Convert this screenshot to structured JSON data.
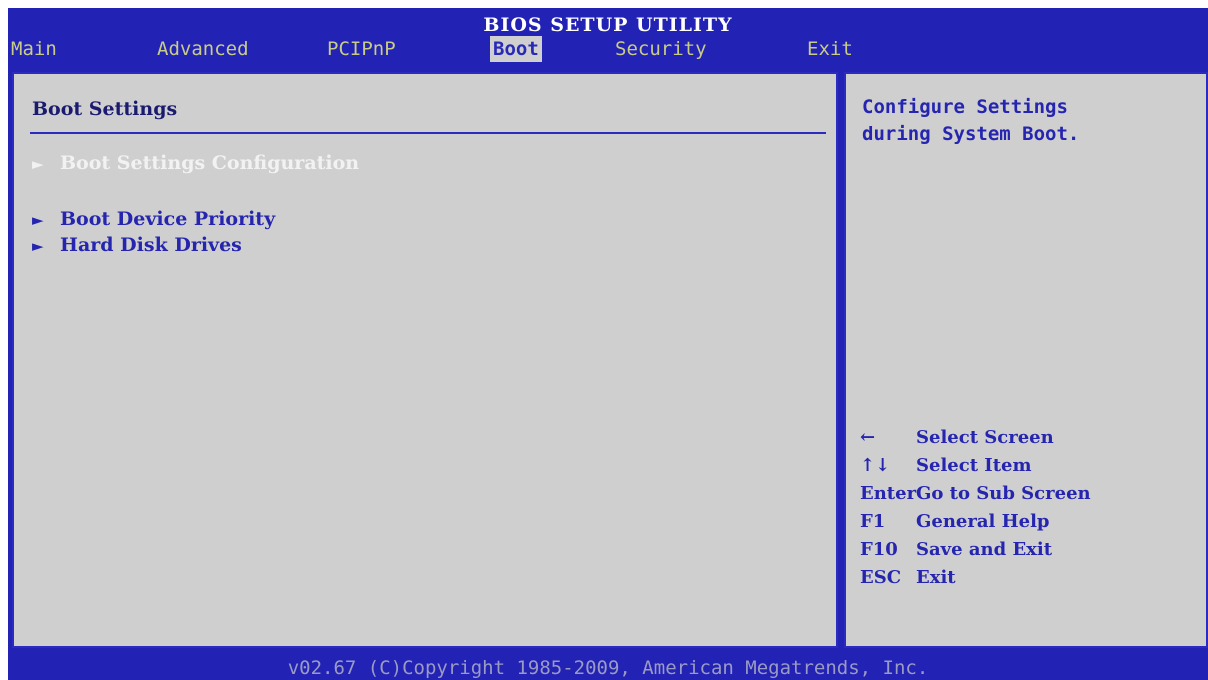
{
  "title": "BIOS SETUP UTILITY",
  "tabs": [
    {
      "label": "Main"
    },
    {
      "label": "Advanced"
    },
    {
      "label": "PCIPnP"
    },
    {
      "label": "Boot"
    },
    {
      "label": "Security"
    },
    {
      "label": "Exit"
    }
  ],
  "active_tab": "Boot",
  "main": {
    "section_title": "Boot Settings",
    "items": [
      {
        "label": "Boot Settings Configuration",
        "arrow": "►"
      },
      {
        "label": "Boot Device Priority",
        "arrow": "►"
      },
      {
        "label": "Hard Disk Drives",
        "arrow": "►"
      }
    ]
  },
  "help": {
    "text_line1": "Configure Settings",
    "text_line2": "during System Boot."
  },
  "keys": [
    {
      "key": "←",
      "action": "Select Screen"
    },
    {
      "key": "↑↓",
      "action": "Select Item"
    },
    {
      "key": "Enter",
      "action": "Go to Sub Screen"
    },
    {
      "key": "F1",
      "action": "General Help"
    },
    {
      "key": "F10",
      "action": "Save and Exit"
    },
    {
      "key": "ESC",
      "action": "Exit"
    }
  ],
  "footer": "v02.67 (C)Copyright 1985-2009, American Megatrends, Inc.",
  "colors": {
    "background": "#2222b4",
    "panel": "#cfcfcf",
    "text_blue": "#2525b0",
    "tab_text": "#c9cc86",
    "highlight": "#f2f2f2"
  }
}
